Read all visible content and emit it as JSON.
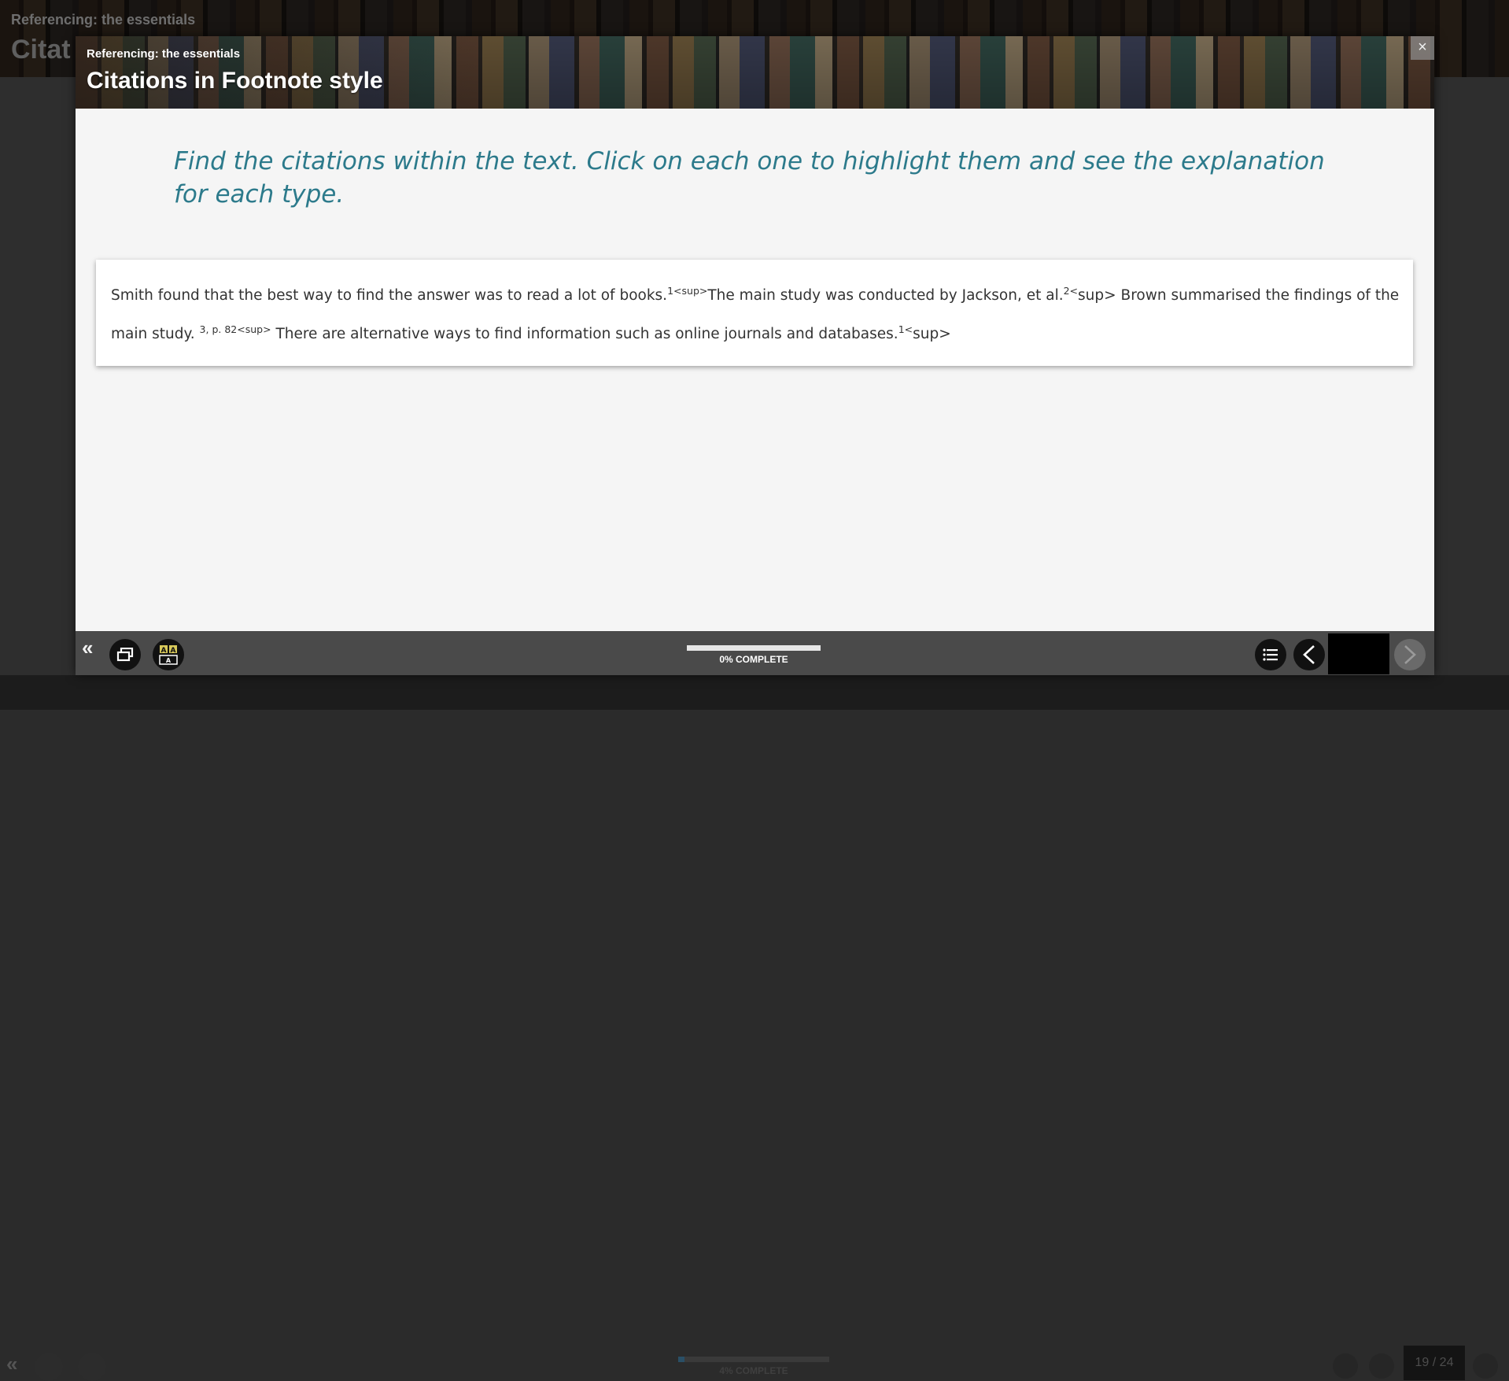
{
  "background": {
    "course_title": "Referencing: the essentials",
    "page_title": "Citat",
    "progress": {
      "percent": 4,
      "label": "4% COMPLETE"
    },
    "page_counter": "19 / 24"
  },
  "modal": {
    "course_title": "Referencing: the essentials",
    "page_title": "Citations in Footnote style",
    "close_label": "×",
    "instruction": "Find the citations within the text. Click on each one to highlight them and see the explanation for each type.",
    "passage": {
      "s1": "Smith found that the best way to find the answer was to read a lot of books.",
      "c1": "1<sup>",
      "s2": "The main study was conducted by Jackson, et al.",
      "c2": "2<",
      "c2b": "sup>",
      "s3": "  Brown summarised the findings of the main study. ",
      "c3": "3, p. 82<sup>",
      "s4": "  There are alternative ways to find information such as online journals and databases.",
      "c4": "1<",
      "c4b": "sup>"
    },
    "footer": {
      "collapse_label": "«",
      "progress": {
        "percent": 0,
        "label": "0% COMPLETE"
      }
    }
  },
  "colors": {
    "accent": "#2c7a8b",
    "footer_bg": "#4a4a4a",
    "button_bg": "#111111"
  },
  "icons": {
    "collapse": "double-chevron-left-icon",
    "resize": "window-restore-icon",
    "text_size": "text-size-icon",
    "menu": "list-menu-icon",
    "prev": "chevron-left-icon",
    "next": "chevron-right-icon",
    "close": "close-icon"
  }
}
